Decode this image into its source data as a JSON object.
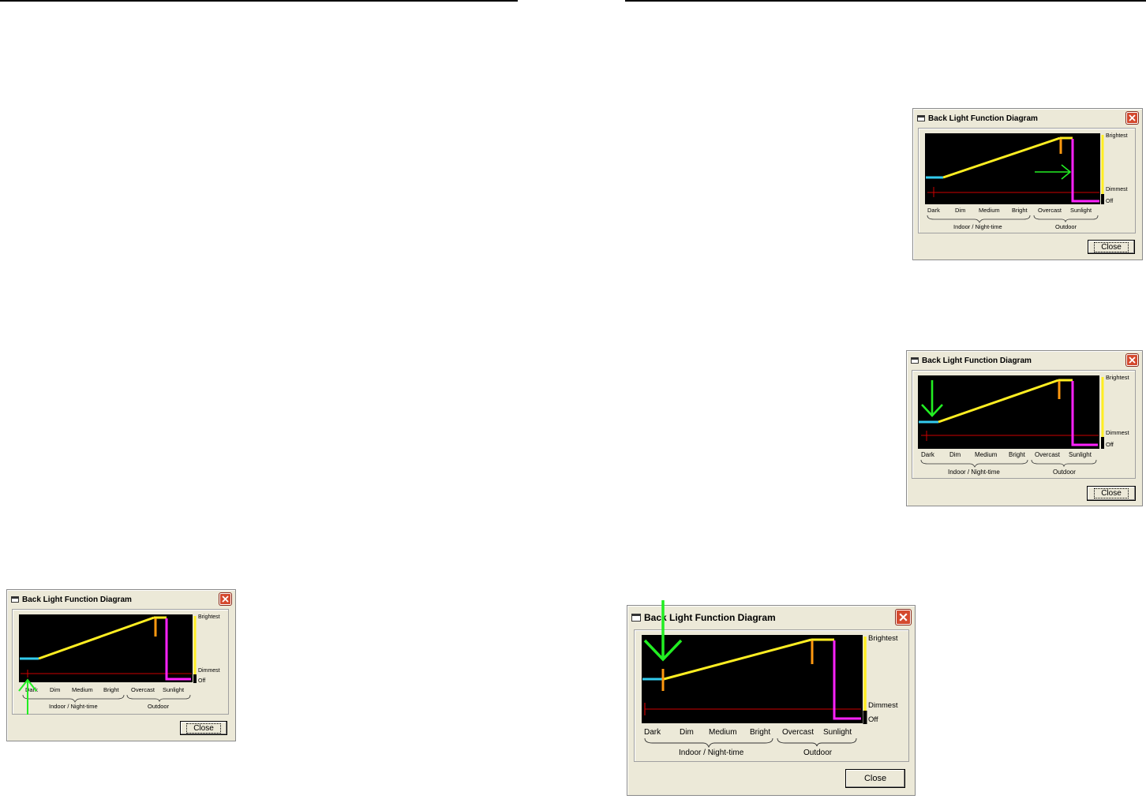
{
  "dialog": {
    "title": "Back Light Function Diagram",
    "close_button_label": "Close",
    "scale_labels": {
      "top": "Brightest",
      "bottom": "Dimmest",
      "off": "Off"
    },
    "light_levels": [
      "Dark",
      "Dim",
      "Medium",
      "Bright",
      "Overcast",
      "Sunlight"
    ],
    "groups": [
      "Indoor / Night-time",
      "Outdoor"
    ]
  },
  "icons": {
    "window_icon": "window-icon",
    "close_icon": "close-x-icon",
    "annotation_arrow": "green-arrow-icon"
  },
  "colors": {
    "window_bg": "#ece9d8",
    "diagram_bg": "#000000",
    "cyan_segment": "#33ccee",
    "yellow_curve": "#ffee22",
    "orange_marker": "#ff9910",
    "magenta_drop": "#ff22ff",
    "red_baseline": "#cc0000",
    "annotation_arrow": "#22ee22",
    "close_button_red": "#d4492e"
  },
  "dialogs": [
    {
      "id": "dialog-1",
      "arrow": "up-at-dark",
      "orange_marker": "none"
    },
    {
      "id": "dialog-2",
      "arrow": "right-toward-sunlight",
      "orange_marker": "overcast"
    },
    {
      "id": "dialog-3",
      "arrow": "down-at-dark",
      "orange_marker": "overcast"
    },
    {
      "id": "dialog-4",
      "arrow": "down-at-dark-large",
      "orange_marker": "dark-and-overcast"
    }
  ]
}
